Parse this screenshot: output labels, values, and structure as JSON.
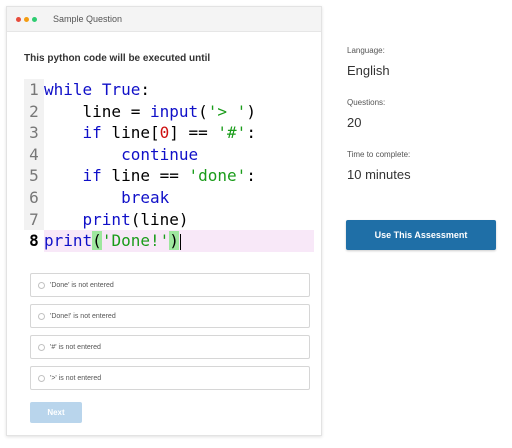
{
  "card": {
    "title": "Sample Question",
    "window_dots": [
      {
        "name": "close-dot",
        "color": "#e74c3c"
      },
      {
        "name": "minimize-dot",
        "color": "#f39c12"
      },
      {
        "name": "maximize-dot",
        "color": "#2ecc71"
      }
    ]
  },
  "question": {
    "text": "This python code will be executed until"
  },
  "code": {
    "line_numbers": [
      "1",
      "2",
      "3",
      "4",
      "5",
      "6",
      "7",
      "8"
    ],
    "active_line": 8
  },
  "options": [
    {
      "label": "'Done' is not entered"
    },
    {
      "label": "'Done!' is not entered"
    },
    {
      "label": "'#' is not entered"
    },
    {
      "label": "'>' is not entered"
    }
  ],
  "next_button": {
    "label": "Next"
  },
  "info": {
    "language_label": "Language:",
    "language_value": "English",
    "questions_label": "Questions:",
    "questions_value": "20",
    "time_label": "Time to complete:",
    "time_value": "10 minutes"
  },
  "use_button": {
    "label": "Use This Assessment"
  },
  "colors": {
    "primary": "#1f6fa7",
    "next_disabled": "#b9d5ec",
    "keyword": "#1010c8",
    "string": "#1a9c1a",
    "number": "#ce1010"
  }
}
